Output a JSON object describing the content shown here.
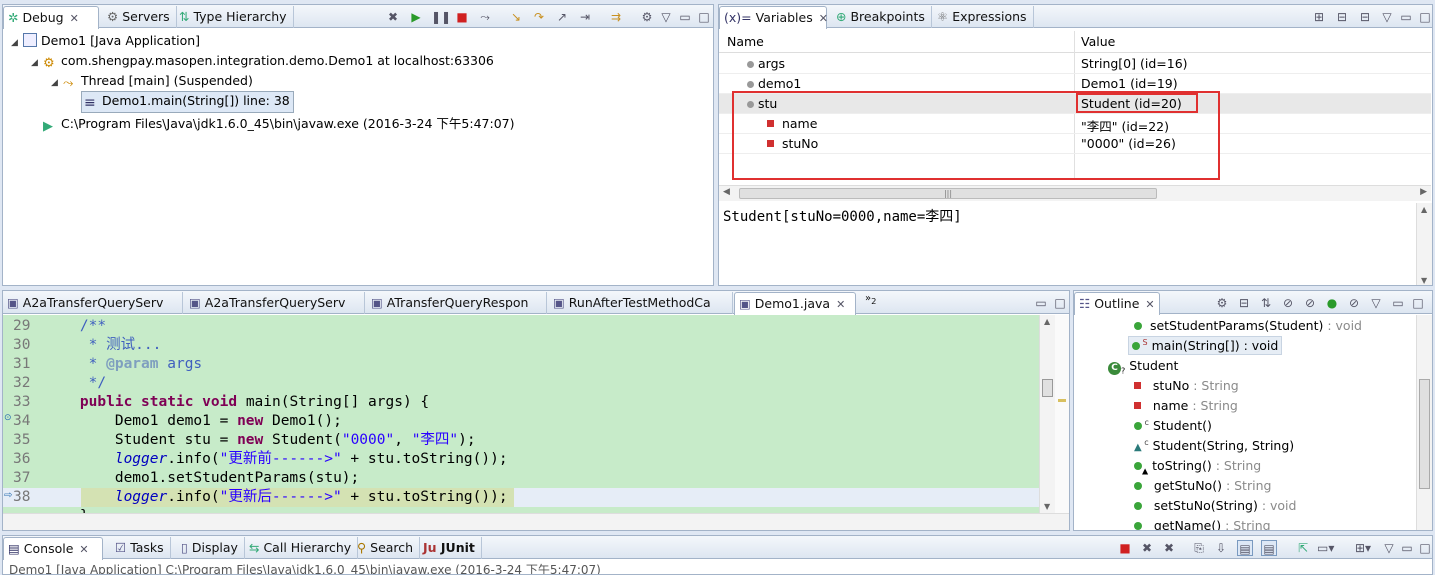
{
  "debug": {
    "tabs": [
      "Debug",
      "Servers",
      "Type Hierarchy"
    ],
    "tree": [
      "Demo1 [Java Application]",
      "com.shengpay.masopen.integration.demo.Demo1 at localhost:63306",
      "Thread [main] (Suspended)",
      "Demo1.main(String[]) line: 38",
      "C:\\Program Files\\Java\\jdk1.6.0_45\\bin\\javaw.exe (2016-3-24 下午5:47:07)"
    ]
  },
  "variables": {
    "tabs": [
      "Variables",
      "Breakpoints",
      "Expressions"
    ],
    "headers": [
      "Name",
      "Value"
    ],
    "rows": [
      {
        "name": "args",
        "value": "String[0]  (id=16)"
      },
      {
        "name": "demo1",
        "value": "Demo1  (id=19)"
      },
      {
        "name": "stu",
        "value": "Student  (id=20)"
      },
      {
        "name": "name",
        "value": "\"李四\" (id=22)"
      },
      {
        "name": "stuNo",
        "value": "\"0000\" (id=26)"
      }
    ],
    "detail": "Student[stuNo=0000,name=李四]"
  },
  "editor": {
    "tabs": [
      "A2aTransferQueryServ",
      "A2aTransferQueryServ",
      "ATransferQueryRespon",
      "RunAfterTestMethodCa",
      "Demo1.java",
      "2"
    ],
    "line_numbers": [
      "29",
      "30",
      "31",
      "32",
      "33",
      "34",
      "35",
      "36",
      "37",
      "38"
    ]
  },
  "outline": {
    "tab": "Outline",
    "items": [
      {
        "n": "setStudentParams(Student)",
        "t": " : void"
      },
      {
        "n": "main(String[]) : void",
        "t": ""
      },
      {
        "n": "Student",
        "t": ""
      },
      {
        "n": "stuNo",
        "t": " : String"
      },
      {
        "n": "name",
        "t": " : String"
      },
      {
        "n": "Student()",
        "t": ""
      },
      {
        "n": "Student(String, String)",
        "t": ""
      },
      {
        "n": "toString()",
        "t": " : String"
      },
      {
        "n": "getStuNo()",
        "t": " : String"
      },
      {
        "n": "setStuNo(String)",
        "t": " : void"
      },
      {
        "n": "getName()",
        "t": " : String"
      }
    ]
  },
  "console": {
    "tabs": [
      "Console",
      "Tasks",
      "Display",
      "Call Hierarchy",
      "Search",
      "JUnit"
    ],
    "status": "Demo1 [Java Application] C:\\Program Files\\Java\\jdk1.6.0_45\\bin\\javaw.exe (2016-3-24 下午5:47:07)"
  },
  "colors": {
    "highlight_box": "#e03030",
    "editor_bg": "#c7ebc9",
    "current_line": "#d0e0b0"
  }
}
